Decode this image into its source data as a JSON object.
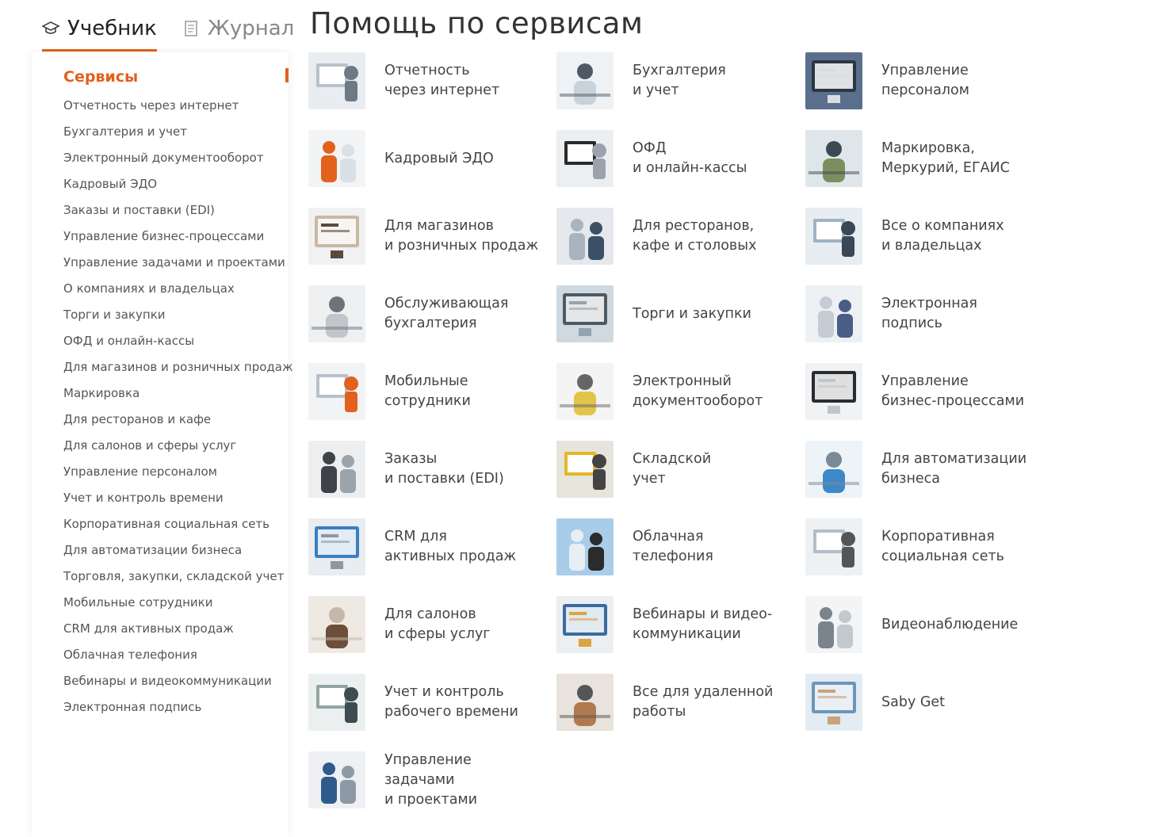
{
  "tabs": [
    {
      "label": "Учебник",
      "icon": "graduation-cap-icon",
      "active": true
    },
    {
      "label": "Журнал",
      "icon": "journal-icon",
      "active": false
    }
  ],
  "page_title": "Помощь по сервисам",
  "sidebar": {
    "heading": "Сервисы",
    "items": [
      "Отчетность через интернет",
      "Бухгалтерия и учет",
      "Электронный документооборот",
      "Кадровый ЭДО",
      "Заказы и поставки (EDI)",
      "Управление бизнес-процессами",
      "Управление задачами и проектами",
      "О компаниях и владельцах",
      "Торги и закупки",
      "ОФД и онлайн-кассы",
      "Для магазинов и розничных продаж",
      "Маркировка",
      "Для ресторанов и кафе",
      "Для салонов и сферы услуг",
      "Управление персоналом",
      "Учет и контроль времени",
      "Корпоративная социальная сеть",
      "Для автоматизации бизнеса",
      "Торговля, закупки, складской учет",
      "Мобильные сотрудники",
      "CRM для активных продаж",
      "Облачная телефония",
      "Вебинары и видеокоммуникации",
      "Электронная подпись"
    ]
  },
  "services": [
    {
      "line1": "Отчетность",
      "line2": "через интернет"
    },
    {
      "line1": "Бухгалтерия",
      "line2": "и учет"
    },
    {
      "line1": "Управление",
      "line2": "персоналом"
    },
    {
      "line1": "Кадровый ЭДО",
      "line2": ""
    },
    {
      "line1": "ОФД",
      "line2": "и онлайн-кассы"
    },
    {
      "line1": "Маркировка,",
      "line2": "Меркурий, ЕГАИС"
    },
    {
      "line1": "Для магазинов",
      "line2": "и розничных продаж"
    },
    {
      "line1": "Для ресторанов,",
      "line2": "кафе и столовых"
    },
    {
      "line1": "Все о компаниях",
      "line2": "и владельцах"
    },
    {
      "line1": "Обслуживающая",
      "line2": "бухгалтерия"
    },
    {
      "line1": "Торги и закупки",
      "line2": ""
    },
    {
      "line1": "Электронная",
      "line2": "подпись"
    },
    {
      "line1": "Мобильные",
      "line2": "сотрудники"
    },
    {
      "line1": "Электронный",
      "line2": "документооборот"
    },
    {
      "line1": "Управление",
      "line2": "бизнес-процессами"
    },
    {
      "line1": "Заказы",
      "line2": "и поставки (EDI)"
    },
    {
      "line1": "Складской",
      "line2": "учет"
    },
    {
      "line1": "Для автоматизации",
      "line2": "бизнеса"
    },
    {
      "line1": "CRM для",
      "line2": "активных продаж"
    },
    {
      "line1": "Облачная",
      "line2": "телефония"
    },
    {
      "line1": "Корпоративная",
      "line2": "социальная сеть"
    },
    {
      "line1": "Для салонов",
      "line2": "и сферы услуг"
    },
    {
      "line1": "Вебинары и видео-",
      "line2": "коммуникации"
    },
    {
      "line1": "Видеонаблюдение",
      "line2": ""
    },
    {
      "line1": "Учет и контроль",
      "line2": "рабочего времени"
    },
    {
      "line1": "Все для удаленной",
      "line2": "работы"
    },
    {
      "line1": "Saby Get",
      "line2": ""
    },
    {
      "line1": "Управление задачами",
      "line2": "и проектами"
    }
  ],
  "colors": {
    "accent": "#e2611c",
    "text": "#444444",
    "sidebar_text": "#555555"
  }
}
